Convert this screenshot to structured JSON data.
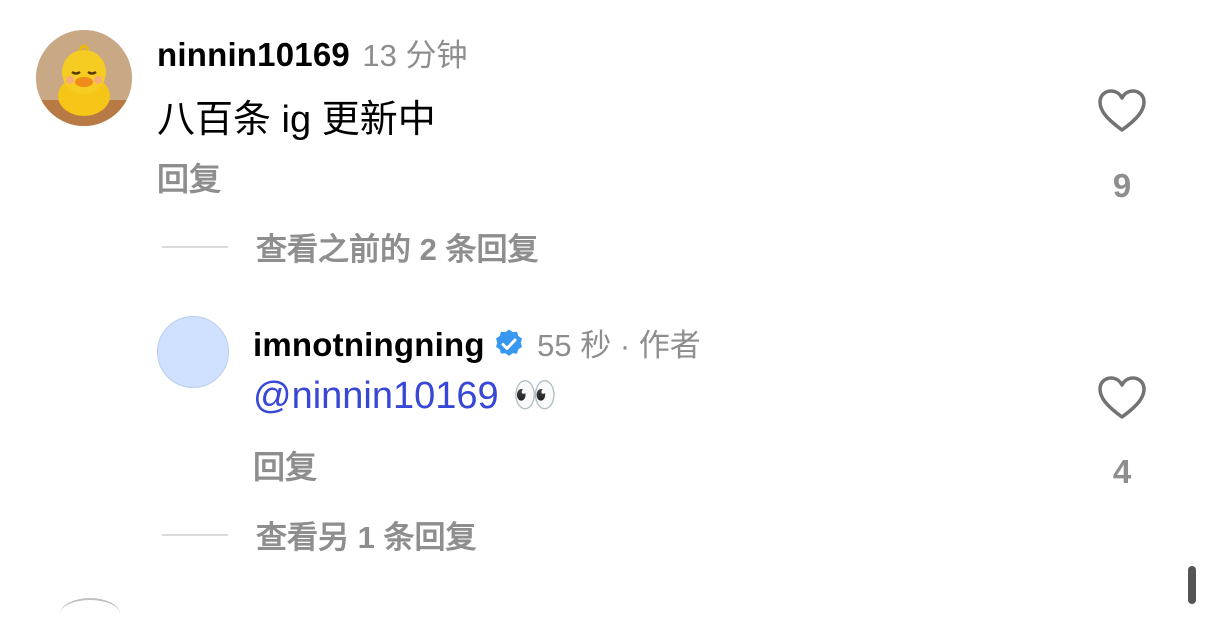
{
  "comments": [
    {
      "username": "ninnin10169",
      "time": "13 分钟",
      "text": "八百条 ig 更新中",
      "reply_label": "回复",
      "like_count": "9",
      "view_replies": "查看之前的 2 条回复",
      "avatar": "duck-avatar"
    },
    {
      "username": "imnotningning",
      "verified": true,
      "time": "55 秒 · 作者",
      "mention": "@ninnin10169",
      "emoji": "👀",
      "reply_label": "回复",
      "like_count": "4",
      "view_replies": "查看另 1 条回复",
      "avatar": "blank-avatar"
    }
  ],
  "colors": {
    "secondary_text": "#8e8e8e",
    "mention": "#3747d6",
    "verified_badge": "#3897f0",
    "avatar2_fill": "#cfe1ff"
  }
}
